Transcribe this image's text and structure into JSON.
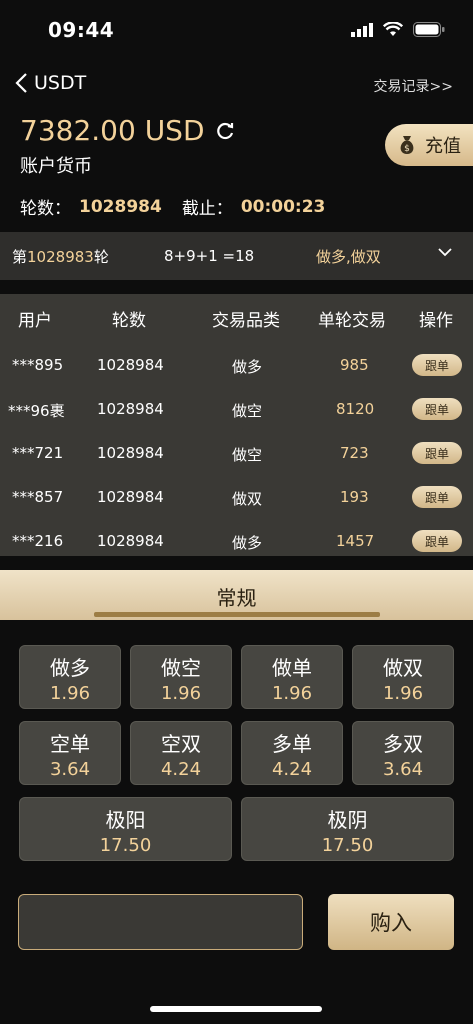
{
  "status": {
    "time": "09:44"
  },
  "nav": {
    "title": "USDT",
    "records_link": "交易记录>>"
  },
  "account": {
    "balance": "7382.00 USD",
    "currency_label": "账户货币",
    "recharge_label": "充值"
  },
  "round": {
    "round_label": "轮数：",
    "round_value": "1028984",
    "deadline_label": "截止：",
    "deadline_value": "00:00:23"
  },
  "previous": {
    "prefix": "第",
    "round": "1028983",
    "suffix": "轮",
    "formula": "8+9+1 =18",
    "result": "做多,做双"
  },
  "table": {
    "headers": [
      "用户",
      "轮数",
      "交易品类",
      "单轮交易",
      "操作"
    ],
    "rows": [
      {
        "user": "***895",
        "round": "1028984",
        "type": "做多",
        "amount": "985",
        "action": "跟单"
      },
      {
        "user": "***96裹",
        "round": "1028984",
        "type": "做空",
        "amount": "8120",
        "action": "跟单"
      },
      {
        "user": "***721",
        "round": "1028984",
        "type": "做空",
        "amount": "723",
        "action": "跟单"
      },
      {
        "user": "***857",
        "round": "1028984",
        "type": "做双",
        "amount": "193",
        "action": "跟单"
      },
      {
        "user": "***216",
        "round": "1028984",
        "type": "做多",
        "amount": "1457",
        "action": "跟单"
      }
    ]
  },
  "tab": {
    "label": "常规"
  },
  "bets": [
    {
      "name": "做多",
      "odds": "1.96"
    },
    {
      "name": "做空",
      "odds": "1.96"
    },
    {
      "name": "做单",
      "odds": "1.96"
    },
    {
      "name": "做双",
      "odds": "1.96"
    },
    {
      "name": "空单",
      "odds": "3.64"
    },
    {
      "name": "空双",
      "odds": "4.24"
    },
    {
      "name": "多单",
      "odds": "4.24"
    },
    {
      "name": "多双",
      "odds": "3.64"
    },
    {
      "name": "极阳",
      "odds": "17.50"
    },
    {
      "name": "极阴",
      "odds": "17.50"
    }
  ],
  "footer": {
    "buy_label": "购入"
  }
}
